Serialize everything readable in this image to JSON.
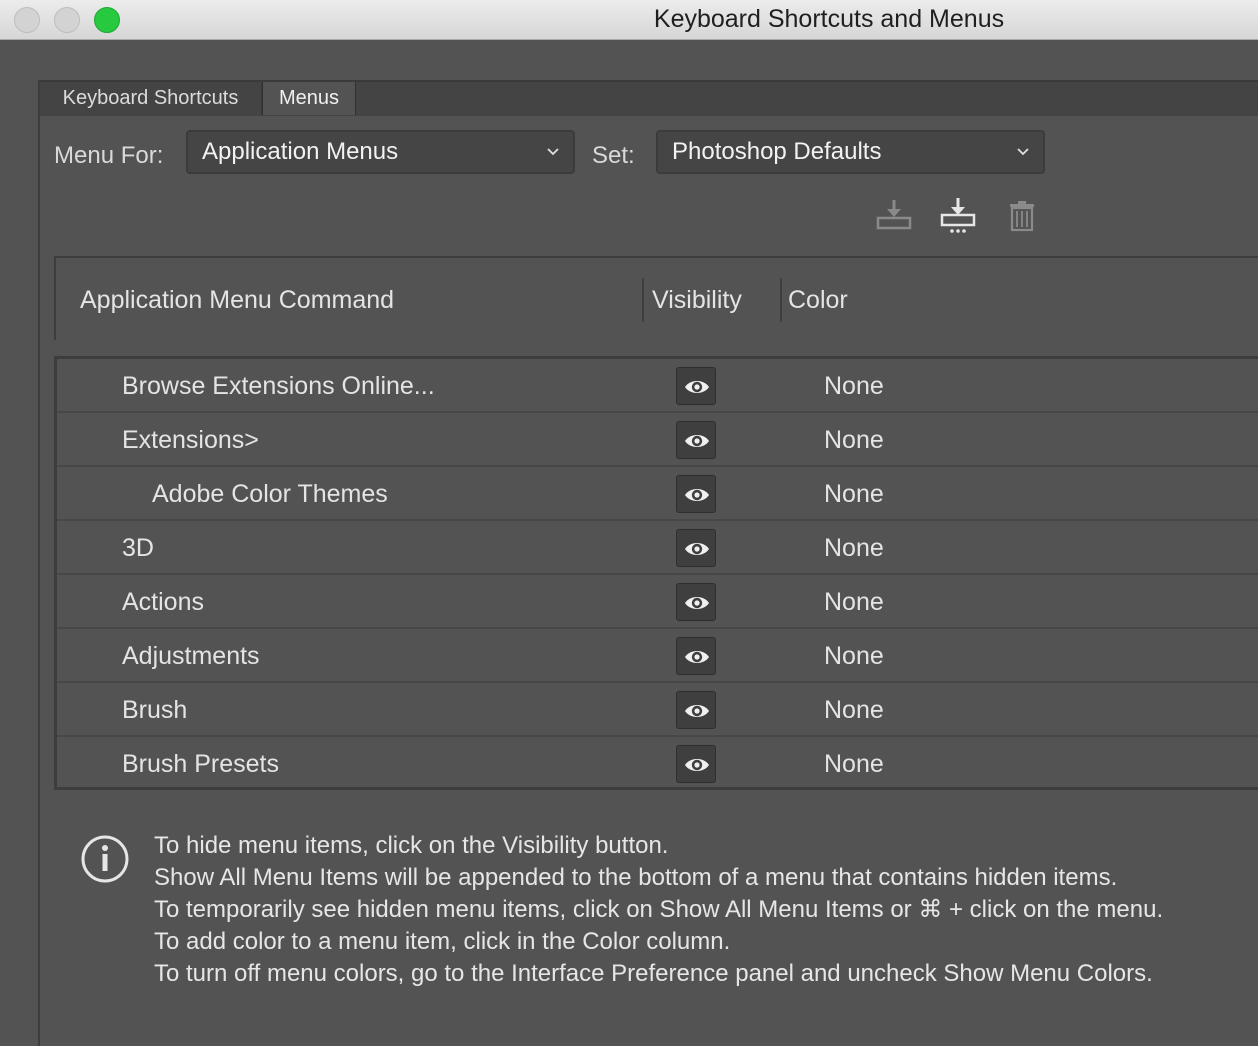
{
  "window": {
    "title": "Keyboard Shortcuts and Menus"
  },
  "tabs": [
    {
      "label": "Keyboard Shortcuts",
      "active": false
    },
    {
      "label": "Menus",
      "active": true
    }
  ],
  "controls": {
    "menu_for_label": "Menu For:",
    "menu_for_value": "Application Menus",
    "set_label": "Set:",
    "set_value": "Photoshop Defaults"
  },
  "toolbar": {
    "icons": [
      "save-set-icon",
      "save-set-as-icon",
      "delete-set-icon"
    ]
  },
  "table": {
    "headers": {
      "command": "Application Menu Command",
      "visibility": "Visibility",
      "color": "Color"
    },
    "rows": [
      {
        "command": "Browse Extensions Online...",
        "indent": 1,
        "visible": true,
        "color": "None"
      },
      {
        "command": "Extensions>",
        "indent": 1,
        "visible": true,
        "color": "None"
      },
      {
        "command": "Adobe Color Themes",
        "indent": 2,
        "visible": true,
        "color": "None"
      },
      {
        "command": "3D",
        "indent": 1,
        "visible": true,
        "color": "None"
      },
      {
        "command": "Actions",
        "indent": 1,
        "visible": true,
        "color": "None"
      },
      {
        "command": "Adjustments",
        "indent": 1,
        "visible": true,
        "color": "None"
      },
      {
        "command": "Brush",
        "indent": 1,
        "visible": true,
        "color": "None"
      },
      {
        "command": "Brush Presets",
        "indent": 1,
        "visible": true,
        "color": "None"
      }
    ]
  },
  "info": {
    "lines": [
      "To hide menu items, click on the Visibility button.",
      "Show All Menu Items will be appended to the bottom of a menu that contains hidden items.",
      "To temporarily see hidden menu items, click on Show All Menu Items or ⌘ + click on the menu.",
      "To add color to a menu item, click in the Color column.",
      "To turn off menu colors, go to the Interface Preference panel and uncheck Show Menu Colors."
    ]
  },
  "colors": {
    "panel_bg": "#535353",
    "accent_green": "#27c93f"
  }
}
